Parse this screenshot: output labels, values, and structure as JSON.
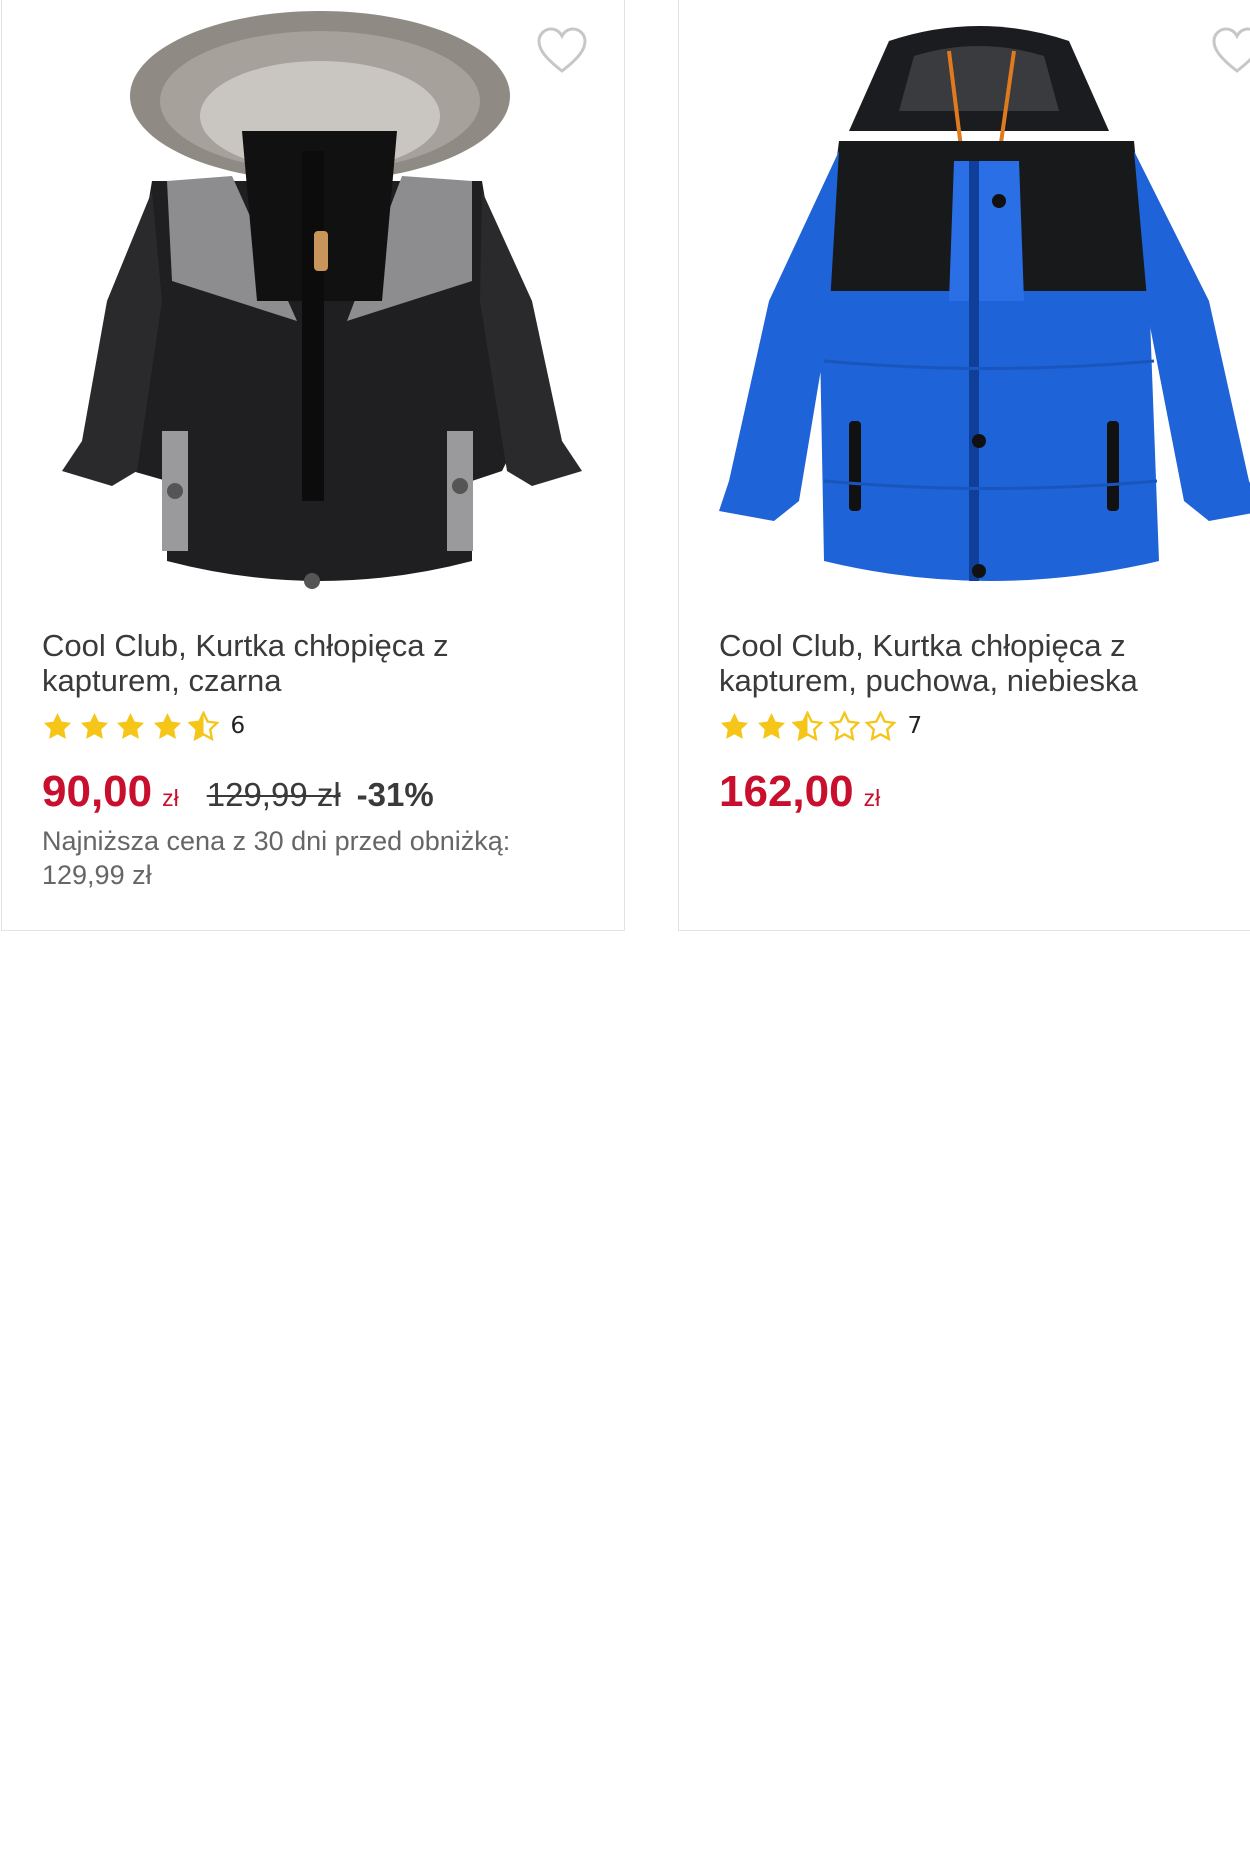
{
  "products": [
    {
      "title": "Cool Club, Kurtka chłopięca z kapturem, czarna",
      "image_alt": "black-winter-jacket-with-fur-hood",
      "rating": 4.5,
      "rating_count": "6",
      "price": "90,00",
      "currency": "zł",
      "old_price": "129,99 zł",
      "discount": "-31%",
      "lowest_price_note": "Najniższa cena z 30 dni przed obniżką: 129,99 zł"
    },
    {
      "title": "Cool Club, Kurtka chłopięca z kapturem, puchowa, niebieska",
      "image_alt": "blue-puffer-jacket-with-black-hood",
      "rating": 2.5,
      "rating_count": "7",
      "price": "162,00",
      "currency": "zł"
    }
  ],
  "colors": {
    "price": "#c8102e",
    "star": "#f5c518",
    "star_empty_stroke": "#f5c518",
    "text": "#3a3a3a",
    "muted": "#666666",
    "border": "#e3e3e3"
  },
  "icons": {
    "favorite": "heart-outline-icon",
    "rating_star": "star-icon"
  }
}
